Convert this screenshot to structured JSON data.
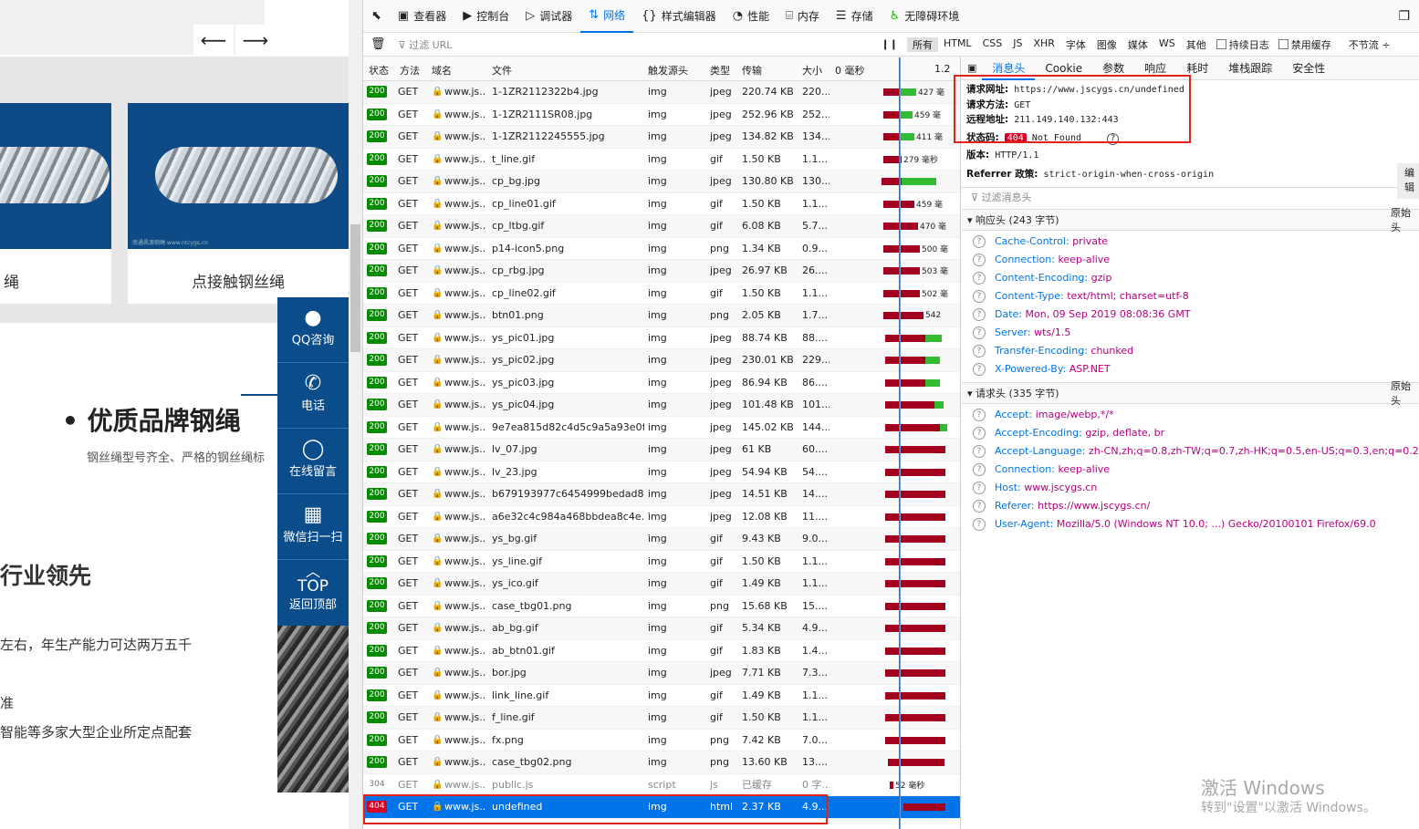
{
  "website": {
    "nav_prev": "⟵",
    "nav_next": "⟶",
    "card1_title": "绳",
    "card2_title": "点接触钢丝绳",
    "card_watermark": "南通昌源钢绳 www.ntcygs.cn",
    "sidebar": [
      {
        "icon": "qq-icon",
        "label": "QQ咨询"
      },
      {
        "icon": "phone-icon",
        "label": "电话"
      },
      {
        "icon": "chat-icon",
        "label": "在线留言"
      },
      {
        "icon": "qr-icon",
        "label": "微信扫一扫"
      }
    ],
    "top_label": "TOP",
    "top_sub": "返回顶部",
    "section_title": "• 优质品牌钢绳",
    "section_bullet": "•",
    "section_sub": "钢丝绳型号齐全、严格的钢丝绳标",
    "lead": "行业领先",
    "line1": "左右，年生产能力可达两万五千",
    "line2": "准",
    "line3": "智能等多家大型企业所定点配套"
  },
  "devtools": {
    "tools": [
      {
        "icon": "pick-icon",
        "label": ""
      },
      {
        "icon": "inspector-icon",
        "label": "查看器"
      },
      {
        "icon": "console-icon",
        "label": "控制台"
      },
      {
        "icon": "debugger-icon",
        "label": "调试器"
      },
      {
        "icon": "network-icon",
        "label": "网络"
      },
      {
        "icon": "style-icon",
        "label": "样式编辑器"
      },
      {
        "icon": "perf-icon",
        "label": "性能"
      },
      {
        "icon": "memory-icon",
        "label": "内存"
      },
      {
        "icon": "storage-icon",
        "label": "存储"
      },
      {
        "icon": "a11y-icon",
        "label": "无障碍环境"
      }
    ],
    "filter_placeholder": "过滤 URL",
    "type_filters": [
      "所有",
      "HTML",
      "CSS",
      "JS",
      "XHR",
      "字体",
      "图像",
      "媒体",
      "WS",
      "其他"
    ],
    "persist_log": "持续日志",
    "disable_cache": "禁用缓存",
    "throttle": "不节流 ÷",
    "columns": [
      "状态",
      "方法",
      "域名",
      "文件",
      "触发源头",
      "类型",
      "传输",
      "大小",
      "0 毫秒",
      "1.2"
    ],
    "rows": [
      {
        "status": "200",
        "method": "GET",
        "domain": "www.js...",
        "file": "1-1ZR2112322b4.jpg",
        "cause": "img",
        "type": "jpeg",
        "transfer": "220.74 KB",
        "size": "220...",
        "timing": "427 毫"
      },
      {
        "status": "200",
        "method": "GET",
        "domain": "www.js...",
        "file": "1-1ZR2111SR08.jpg",
        "cause": "img",
        "type": "jpeg",
        "transfer": "252.96 KB",
        "size": "252...",
        "timing": "459 毫"
      },
      {
        "status": "200",
        "method": "GET",
        "domain": "www.js...",
        "file": "1-1ZR2112245555.jpg",
        "cause": "img",
        "type": "jpeg",
        "transfer": "134.82 KB",
        "size": "134...",
        "timing": "411 毫"
      },
      {
        "status": "200",
        "method": "GET",
        "domain": "www.js...",
        "file": "t_line.gif",
        "cause": "img",
        "type": "gif",
        "transfer": "1.50 KB",
        "size": "1.1...",
        "timing": "279 毫秒"
      },
      {
        "status": "200",
        "method": "GET",
        "domain": "www.js...",
        "file": "cp_bg.jpg",
        "cause": "img",
        "type": "jpeg",
        "transfer": "130.80 KB",
        "size": "130...",
        "timing": ""
      },
      {
        "status": "200",
        "method": "GET",
        "domain": "www.js...",
        "file": "cp_line01.gif",
        "cause": "img",
        "type": "gif",
        "transfer": "1.50 KB",
        "size": "1.1...",
        "timing": "459 毫"
      },
      {
        "status": "200",
        "method": "GET",
        "domain": "www.js...",
        "file": "cp_ltbg.gif",
        "cause": "img",
        "type": "gif",
        "transfer": "6.08 KB",
        "size": "5.7...",
        "timing": "470 毫"
      },
      {
        "status": "200",
        "method": "GET",
        "domain": "www.js...",
        "file": "p14-icon5.png",
        "cause": "img",
        "type": "png",
        "transfer": "1.34 KB",
        "size": "0.9...",
        "timing": "500 毫"
      },
      {
        "status": "200",
        "method": "GET",
        "domain": "www.js...",
        "file": "cp_rbg.jpg",
        "cause": "img",
        "type": "jpeg",
        "transfer": "26.97 KB",
        "size": "26....",
        "timing": "503 毫"
      },
      {
        "status": "200",
        "method": "GET",
        "domain": "www.js...",
        "file": "cp_line02.gif",
        "cause": "img",
        "type": "gif",
        "transfer": "1.50 KB",
        "size": "1.1...",
        "timing": "502 毫"
      },
      {
        "status": "200",
        "method": "GET",
        "domain": "www.js...",
        "file": "btn01.png",
        "cause": "img",
        "type": "png",
        "transfer": "2.05 KB",
        "size": "1.7...",
        "timing": "542"
      },
      {
        "status": "200",
        "method": "GET",
        "domain": "www.js...",
        "file": "ys_pic01.jpg",
        "cause": "img",
        "type": "jpeg",
        "transfer": "88.74 KB",
        "size": "88....",
        "timing": ""
      },
      {
        "status": "200",
        "method": "GET",
        "domain": "www.js...",
        "file": "ys_pic02.jpg",
        "cause": "img",
        "type": "jpeg",
        "transfer": "230.01 KB",
        "size": "229...",
        "timing": ""
      },
      {
        "status": "200",
        "method": "GET",
        "domain": "www.js...",
        "file": "ys_pic03.jpg",
        "cause": "img",
        "type": "jpeg",
        "transfer": "86.94 KB",
        "size": "86....",
        "timing": ""
      },
      {
        "status": "200",
        "method": "GET",
        "domain": "www.js...",
        "file": "ys_pic04.jpg",
        "cause": "img",
        "type": "jpeg",
        "transfer": "101.48 KB",
        "size": "101...",
        "timing": ""
      },
      {
        "status": "200",
        "method": "GET",
        "domain": "www.js...",
        "file": "9e7ea815d82c4d5c9a5a93e0f...",
        "cause": "img",
        "type": "jpeg",
        "transfer": "145.02 KB",
        "size": "144...",
        "timing": ""
      },
      {
        "status": "200",
        "method": "GET",
        "domain": "www.js...",
        "file": "lv_07.jpg",
        "cause": "img",
        "type": "jpeg",
        "transfer": "61 KB",
        "size": "60....",
        "timing": ""
      },
      {
        "status": "200",
        "method": "GET",
        "domain": "www.js...",
        "file": "lv_23.jpg",
        "cause": "img",
        "type": "jpeg",
        "transfer": "54.94 KB",
        "size": "54....",
        "timing": ""
      },
      {
        "status": "200",
        "method": "GET",
        "domain": "www.js...",
        "file": "b679193977c6454999bedad8...",
        "cause": "img",
        "type": "jpeg",
        "transfer": "14.51 KB",
        "size": "14....",
        "timing": ""
      },
      {
        "status": "200",
        "method": "GET",
        "domain": "www.js...",
        "file": "a6e32c4c984a468bbdea8c4e...",
        "cause": "img",
        "type": "jpeg",
        "transfer": "12.08 KB",
        "size": "11....",
        "timing": ""
      },
      {
        "status": "200",
        "method": "GET",
        "domain": "www.js...",
        "file": "ys_bg.gif",
        "cause": "img",
        "type": "gif",
        "transfer": "9.43 KB",
        "size": "9.0...",
        "timing": ""
      },
      {
        "status": "200",
        "method": "GET",
        "domain": "www.js...",
        "file": "ys_line.gif",
        "cause": "img",
        "type": "gif",
        "transfer": "1.50 KB",
        "size": "1.1...",
        "timing": ""
      },
      {
        "status": "200",
        "method": "GET",
        "domain": "www.js...",
        "file": "ys_ico.gif",
        "cause": "img",
        "type": "gif",
        "transfer": "1.49 KB",
        "size": "1.1...",
        "timing": ""
      },
      {
        "status": "200",
        "method": "GET",
        "domain": "www.js...",
        "file": "case_tbg01.png",
        "cause": "img",
        "type": "png",
        "transfer": "15.68 KB",
        "size": "15....",
        "timing": ""
      },
      {
        "status": "200",
        "method": "GET",
        "domain": "www.js...",
        "file": "ab_bg.gif",
        "cause": "img",
        "type": "gif",
        "transfer": "5.34 KB",
        "size": "4.9...",
        "timing": ""
      },
      {
        "status": "200",
        "method": "GET",
        "domain": "www.js...",
        "file": "ab_btn01.gif",
        "cause": "img",
        "type": "gif",
        "transfer": "1.83 KB",
        "size": "1.4...",
        "timing": ""
      },
      {
        "status": "200",
        "method": "GET",
        "domain": "www.js...",
        "file": "bor.jpg",
        "cause": "img",
        "type": "jpeg",
        "transfer": "7.71 KB",
        "size": "7.3...",
        "timing": ""
      },
      {
        "status": "200",
        "method": "GET",
        "domain": "www.js...",
        "file": "link_line.gif",
        "cause": "img",
        "type": "gif",
        "transfer": "1.49 KB",
        "size": "1.1...",
        "timing": ""
      },
      {
        "status": "200",
        "method": "GET",
        "domain": "www.js...",
        "file": "f_line.gif",
        "cause": "img",
        "type": "gif",
        "transfer": "1.50 KB",
        "size": "1.1...",
        "timing": ""
      },
      {
        "status": "200",
        "method": "GET",
        "domain": "www.js...",
        "file": "fx.png",
        "cause": "img",
        "type": "png",
        "transfer": "7.42 KB",
        "size": "7.0...",
        "timing": ""
      },
      {
        "status": "200",
        "method": "GET",
        "domain": "www.js...",
        "file": "case_tbg02.png",
        "cause": "img",
        "type": "png",
        "transfer": "13.60 KB",
        "size": "13....",
        "timing": ""
      },
      {
        "status": "304",
        "method": "GET",
        "domain": "www.js...",
        "file": "public.js",
        "cause": "script",
        "type": "js",
        "transfer": "已缓存",
        "size": "0 字...",
        "timing": "52 毫秒"
      },
      {
        "status": "404",
        "method": "GET",
        "domain": "www.js...",
        "file": "undefined",
        "cause": "img",
        "type": "html",
        "transfer": "2.37 KB",
        "size": "4.9...",
        "timing": ""
      }
    ],
    "detail_tabs": [
      "消息头",
      "Cookie",
      "参数",
      "响应",
      "耗时",
      "堆栈跟踪",
      "安全性"
    ],
    "summary": {
      "url_label": "请求网址:",
      "url": "https://www.jscygs.cn/undefined",
      "method_label": "请求方法:",
      "method": "GET",
      "remote_label": "远程地址:",
      "remote": "211.149.140.132:443",
      "status_label": "状态码:",
      "status_code": "404",
      "status_text": "Not Found",
      "help": "?",
      "version_label": "版本:",
      "version": "HTTP/1.1",
      "referrer_label": "Referrer 政策:",
      "referrer": "strict-origin-when-cross-origin",
      "edit": "编辑"
    },
    "filter_headers": "过滤消息头",
    "response_headers_title": "响应头 (243 字节)",
    "raw_headers": "原始头",
    "response_headers": [
      {
        "k": "Cache-Control:",
        "v": "private"
      },
      {
        "k": "Connection:",
        "v": "keep-alive"
      },
      {
        "k": "Content-Encoding:",
        "v": "gzip"
      },
      {
        "k": "Content-Type:",
        "v": "text/html; charset=utf-8"
      },
      {
        "k": "Date:",
        "v": "Mon, 09 Sep 2019 08:08:36 GMT"
      },
      {
        "k": "Server:",
        "v": "wts/1.5"
      },
      {
        "k": "Transfer-Encoding:",
        "v": "chunked"
      },
      {
        "k": "X-Powered-By:",
        "v": "ASP.NET"
      }
    ],
    "request_headers_title": "请求头 (335 字节)",
    "request_headers": [
      {
        "k": "Accept:",
        "v": "image/webp,*/*"
      },
      {
        "k": "Accept-Encoding:",
        "v": "gzip, deflate, br"
      },
      {
        "k": "Accept-Language:",
        "v": "zh-CN,zh;q=0.8,zh-TW;q=0.7,zh-HK;q=0.5,en-US;q=0.3,en;q=0.2"
      },
      {
        "k": "Connection:",
        "v": "keep-alive"
      },
      {
        "k": "Host:",
        "v": "www.jscygs.cn"
      },
      {
        "k": "Referer:",
        "v": "https://www.jscygs.cn/"
      },
      {
        "k": "User-Agent:",
        "v": "Mozilla/5.0 (Windows NT 10.0; ...) Gecko/20100101 Firefox/69.0"
      }
    ]
  },
  "os": {
    "activate_title": "激活 Windows",
    "activate_sub": "转到\"设置\"以激活 Windows。"
  },
  "colors": {
    "accent": "#0074e8",
    "ok": "#058b00",
    "error": "#d70022",
    "highlight": "#e0241b"
  }
}
